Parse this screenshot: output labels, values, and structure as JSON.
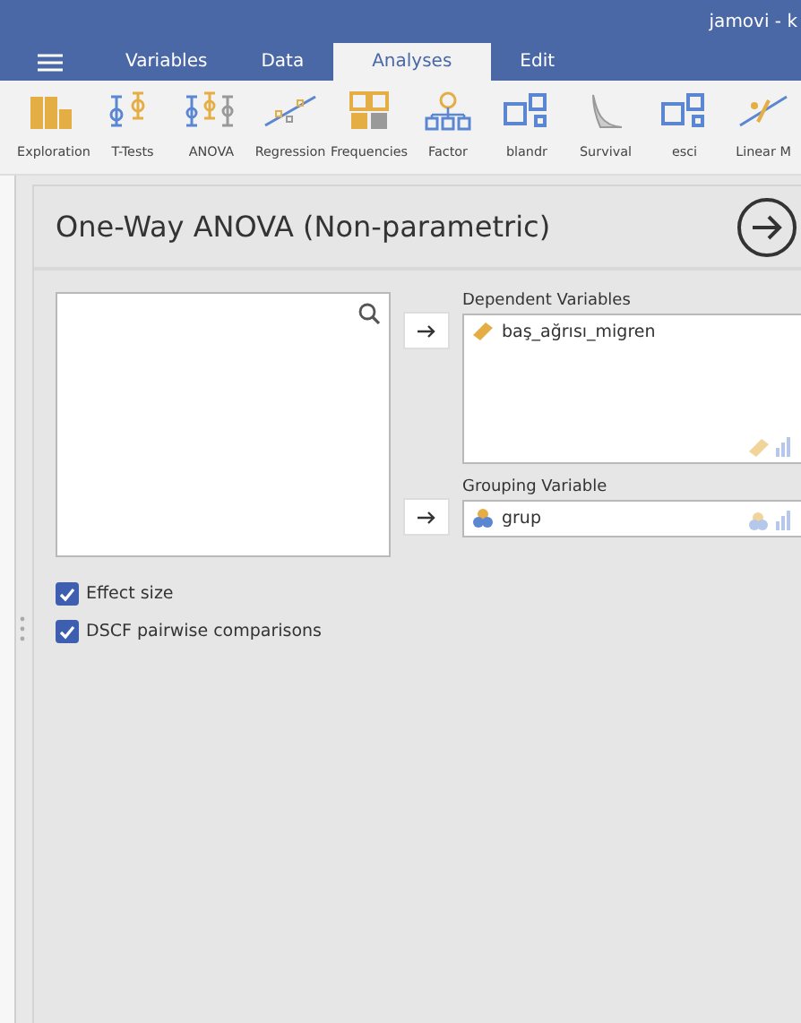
{
  "window": {
    "title": "jamovi - k"
  },
  "tabs": [
    {
      "label": "Variables",
      "selected": false
    },
    {
      "label": "Data",
      "selected": false
    },
    {
      "label": "Analyses",
      "selected": true
    },
    {
      "label": "Edit",
      "selected": false
    }
  ],
  "toolbar": [
    {
      "label": "Exploration"
    },
    {
      "label": "T-Tests"
    },
    {
      "label": "ANOVA"
    },
    {
      "label": "Regression"
    },
    {
      "label": "Frequencies"
    },
    {
      "label": "Factor"
    },
    {
      "label": "blandr"
    },
    {
      "label": "Survival"
    },
    {
      "label": "esci"
    },
    {
      "label": "Linear M"
    }
  ],
  "analysis": {
    "title": "One-Way ANOVA (Non-parametric)",
    "dependent_variables": {
      "label": "Dependent Variables",
      "items": [
        {
          "name": "baş_ağrısı_migren",
          "kind": "continuous"
        }
      ]
    },
    "grouping_variable": {
      "label": "Grouping Variable",
      "items": [
        {
          "name": "grup",
          "kind": "nominal"
        }
      ]
    },
    "options": [
      {
        "label": "Effect size",
        "checked": true
      },
      {
        "label": "DSCF pairwise comparisons",
        "checked": true
      }
    ]
  }
}
